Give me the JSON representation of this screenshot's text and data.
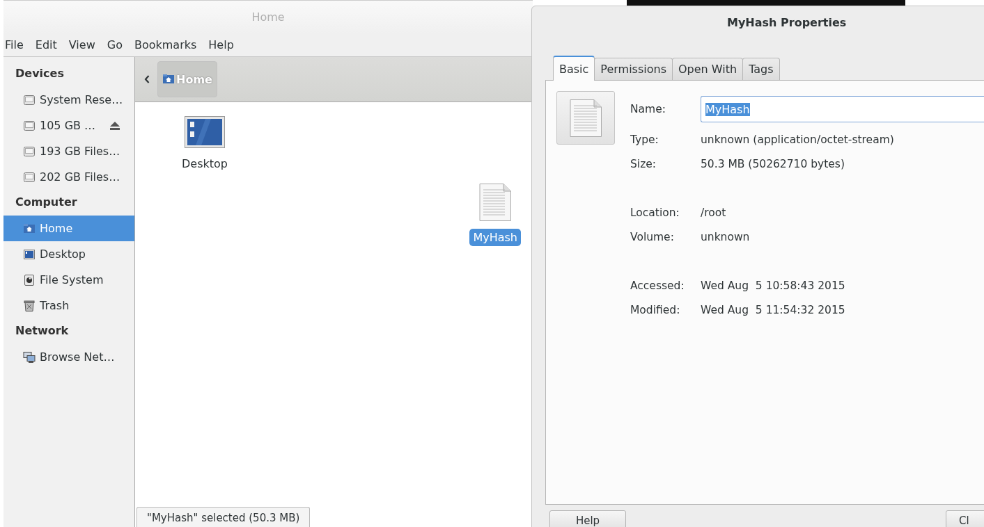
{
  "file_manager": {
    "title": "Home",
    "menu": [
      "File",
      "Edit",
      "View",
      "Go",
      "Bookmarks",
      "Help"
    ],
    "sidebar": [
      {
        "heading": "Devices",
        "items": [
          {
            "label": "System Rese…",
            "kind": "drive",
            "eject": false,
            "selected": false
          },
          {
            "label": "105 GB …",
            "kind": "drive",
            "eject": true,
            "selected": false
          },
          {
            "label": "193 GB Files…",
            "kind": "drive",
            "eject": false,
            "selected": false
          },
          {
            "label": "202 GB Files…",
            "kind": "drive",
            "eject": false,
            "selected": false
          }
        ]
      },
      {
        "heading": "Computer",
        "items": [
          {
            "label": "Home",
            "kind": "home",
            "eject": false,
            "selected": true
          },
          {
            "label": "Desktop",
            "kind": "desktop",
            "eject": false,
            "selected": false
          },
          {
            "label": "File System",
            "kind": "filesystem",
            "eject": false,
            "selected": false
          },
          {
            "label": "Trash",
            "kind": "trash",
            "eject": false,
            "selected": false
          }
        ]
      },
      {
        "heading": "Network",
        "items": [
          {
            "label": "Browse Net…",
            "kind": "network",
            "eject": false,
            "selected": false
          }
        ]
      }
    ],
    "path_button": "Home",
    "files": [
      {
        "name": "Desktop",
        "kind": "desktop",
        "selected": false
      },
      {
        "name": "MyHash",
        "kind": "document",
        "selected": true
      }
    ],
    "status": "\"MyHash\" selected (50.3 MB)"
  },
  "properties": {
    "title": "MyHash Properties",
    "tabs": [
      {
        "label": "Basic",
        "selected": true
      },
      {
        "label": "Permissions",
        "selected": false
      },
      {
        "label": "Open With",
        "selected": false
      },
      {
        "label": "Tags",
        "selected": false
      }
    ],
    "sections": [
      [
        {
          "label": "Name:",
          "value": "MyHash",
          "kind": "field"
        },
        {
          "label": "Type:",
          "value": "unknown (application/octet-stream)",
          "kind": "text"
        },
        {
          "label": "Size:",
          "value": "50.3 MB (50262710 bytes)",
          "kind": "text"
        }
      ],
      [
        {
          "label": "Location:",
          "value": "/root",
          "kind": "text"
        },
        {
          "label": "Volume:",
          "value": "unknown",
          "kind": "text"
        }
      ],
      [
        {
          "label": "Accessed:",
          "value": "Wed Aug  5 10:58:43 2015",
          "kind": "text"
        },
        {
          "label": "Modified:",
          "value": "Wed Aug  5 11:54:32 2015",
          "kind": "text"
        }
      ]
    ],
    "buttons": [
      "Help",
      "Cl"
    ]
  }
}
